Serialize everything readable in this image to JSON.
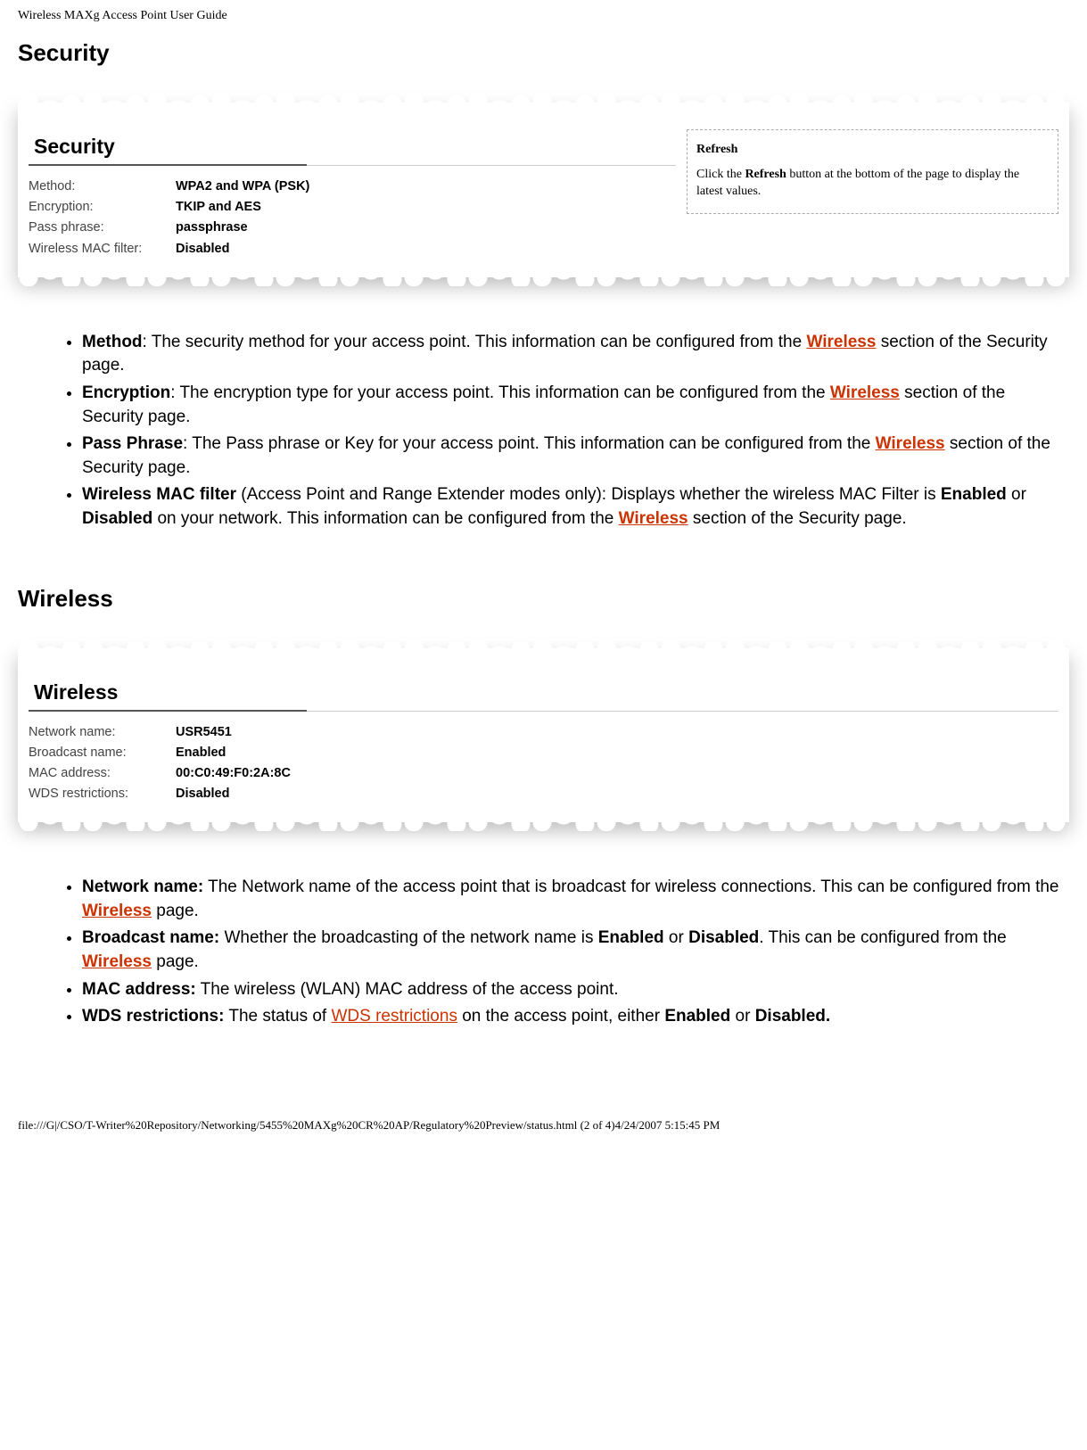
{
  "header": {
    "title": "Wireless MAXg Access Point User Guide"
  },
  "security": {
    "heading": "Security",
    "panel_title": "Security",
    "rows": {
      "method_label": "Method:",
      "method_value": "WPA2 and WPA (PSK)",
      "encryption_label": "Encryption:",
      "encryption_value": "TKIP and AES",
      "passphrase_label": "Pass phrase:",
      "passphrase_value": "passphrase",
      "macfilter_label": "Wireless MAC filter:",
      "macfilter_value": "Disabled"
    },
    "callout": {
      "title": "Refresh",
      "text_before": "Click the ",
      "bold": "Refresh",
      "text_after": " button at the bottom of the page to display the latest values."
    },
    "bullets": {
      "method_term": "Method",
      "method_after": ": The security method for your access point. This information can be configured from the ",
      "method_tail": " section of the Security page.",
      "encryption_term": "Encryption",
      "encryption_after": ": The encryption type for your access point. This information can be configured from the ",
      "encryption_tail": " section of the Security page.",
      "pass_term": "Pass Phrase",
      "pass_after": ": The Pass phrase or Key for your access point. This information can be configured from the ",
      "pass_tail": " section of the Security page.",
      "mac_term": "Wireless MAC filter",
      "mac_after1": " (Access Point and Range Extender modes only): Displays whether the wireless MAC Filter is ",
      "mac_enabled": "Enabled",
      "mac_or": " or ",
      "mac_disabled": "Disabled",
      "mac_after2": " on your network. This information can be configured from the ",
      "mac_tail": " section of the Security page."
    },
    "link_text": "Wireless"
  },
  "wireless": {
    "heading": "Wireless",
    "panel_title": "Wireless",
    "rows": {
      "network_label": "Network name:",
      "network_value": "USR5451",
      "broadcast_label": "Broadcast name:",
      "broadcast_value": "Enabled",
      "mac_label": "MAC address:",
      "mac_value": "00:C0:49:F0:2A:8C",
      "wds_label": "WDS restrictions:",
      "wds_value": "Disabled"
    },
    "bullets": {
      "net_term": "Network name:",
      "net_after": " The Network name of the access point that is broadcast for wireless connections. This can be configured from the ",
      "net_tail": " page.",
      "bcast_term": "Broadcast name:",
      "bcast_after1": " Whether the broadcasting of the network name is ",
      "bcast_enabled": "Enabled",
      "bcast_or": " or ",
      "bcast_disabled": "Disabled",
      "bcast_after2": ". This can be configured from the ",
      "bcast_tail": " page.",
      "mac_term": "MAC address:",
      "mac_after": " The wireless (WLAN) MAC address of the access point.",
      "wds_term": "WDS restrictions:",
      "wds_after1": " The status of ",
      "wds_link": "WDS restrictions",
      "wds_after2": " on the access point, either ",
      "wds_enabled": "Enabled",
      "wds_or": " or ",
      "wds_disabled": "Disabled."
    },
    "link_text": "Wireless"
  },
  "footer": {
    "text": "file:///G|/CSO/T-Writer%20Repository/Networking/5455%20MAXg%20CR%20AP/Regulatory%20Preview/status.html (2 of 4)4/24/2007 5:15:45 PM"
  }
}
